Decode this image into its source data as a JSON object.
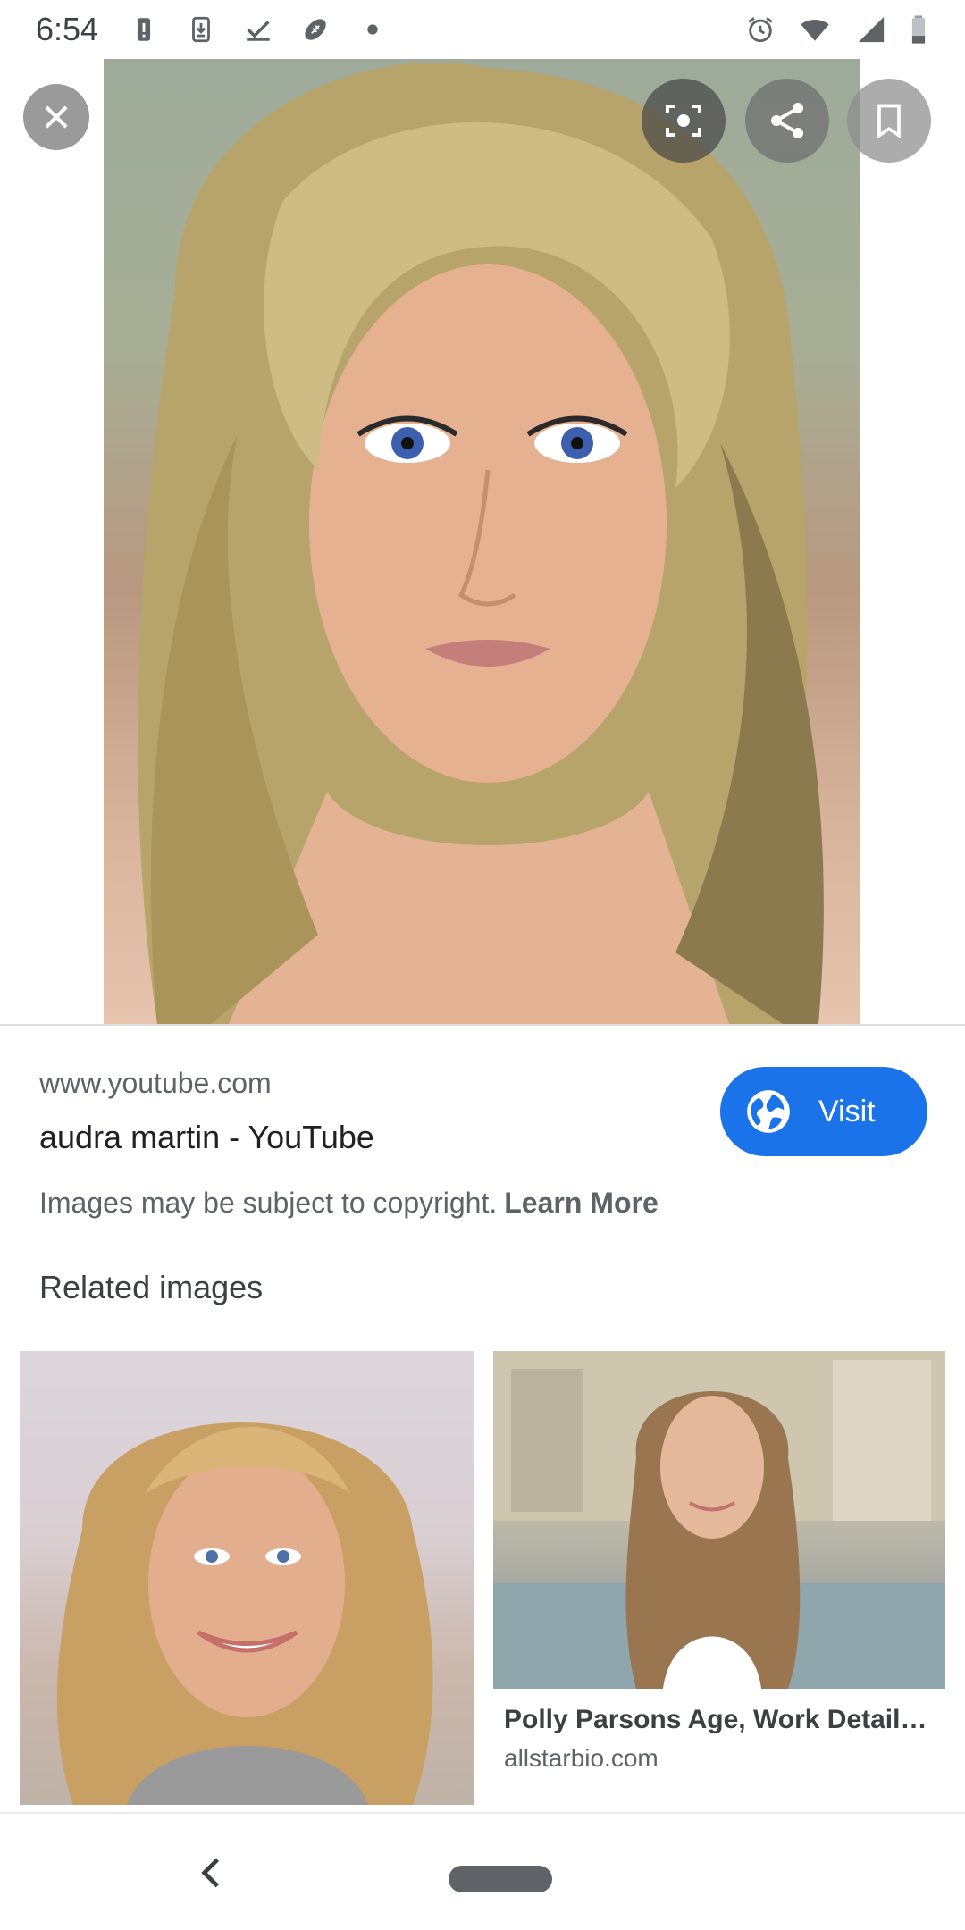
{
  "status_bar": {
    "time": "6:54",
    "left_icons": [
      "alert-icon",
      "download-icon",
      "check-icon",
      "football-icon",
      "dot-icon"
    ],
    "right_icons": [
      "alarm-icon",
      "wifi-icon",
      "signal-icon",
      "battery-icon"
    ]
  },
  "viewer": {
    "buttons": [
      "close-icon",
      "lens-icon",
      "share-icon",
      "bookmark-icon"
    ]
  },
  "source": {
    "domain": "www.youtube.com",
    "title": "audra martin - YouTube",
    "visit_label": "Visit",
    "copyright_text": "Images may be subject to copyright.",
    "learn_more": "Learn More"
  },
  "related": {
    "heading": "Related images",
    "items": [
      {
        "title": "",
        "source": ""
      },
      {
        "title": "Polly Parsons Age, Work Details,…",
        "source": "allstarbio.com"
      }
    ]
  },
  "colors": {
    "accent": "#1a73e8",
    "text_primary": "#202124",
    "text_secondary": "#5f6368"
  }
}
